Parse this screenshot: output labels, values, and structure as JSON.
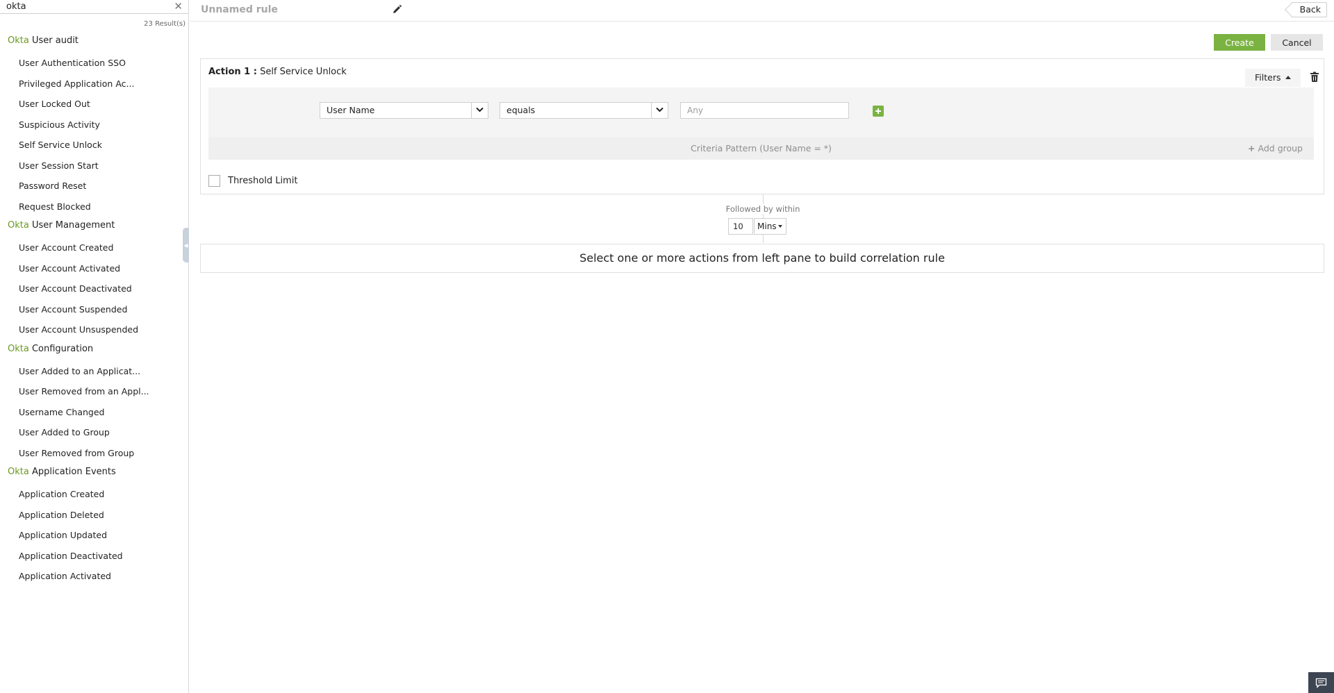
{
  "sidebar": {
    "search": {
      "value": "okta",
      "clear_icon": "close-icon"
    },
    "result_count": "23 Result(s)",
    "groups": [
      {
        "brand": "Okta",
        "name": "User audit",
        "items": [
          "User Authentication SSO",
          "Privileged Application Ac...",
          "User Locked Out",
          "Suspicious Activity",
          "Self Service Unlock",
          "User Session Start",
          "Password Reset",
          "Request Blocked"
        ]
      },
      {
        "brand": "Okta",
        "name": "User Management",
        "items": [
          "User Account Created",
          "User Account Activated",
          "User Account Deactivated",
          "User Account Suspended",
          "User Account Unsuspended"
        ]
      },
      {
        "brand": "Okta",
        "name": "Configuration",
        "items": [
          "User Added to an Applicat...",
          "User Removed from an Appl...",
          "Username Changed",
          "User Added to Group",
          "User Removed from Group"
        ]
      },
      {
        "brand": "Okta",
        "name": "Application Events",
        "items": [
          "Application Created",
          "Application Deleted",
          "Application Updated",
          "Application Deactivated",
          "Application Activated"
        ]
      }
    ]
  },
  "header": {
    "rule_name": "Unnamed rule",
    "edit_icon": "pencil-icon",
    "back_label": "Back"
  },
  "toolbar": {
    "create_label": "Create",
    "cancel_label": "Cancel"
  },
  "action": {
    "label": "Action 1 :",
    "name": "Self Service Unlock",
    "filters_label": "Filters",
    "delete_icon": "trash-icon",
    "criteria": {
      "field": "User Name",
      "operator": "equals",
      "value_placeholder": "Any"
    },
    "criteria_pattern": "Criteria Pattern (User Name = *)",
    "add_group_label": "Add group",
    "threshold_label": "Threshold Limit",
    "threshold_checked": false
  },
  "followed_by": {
    "label": "Followed by within",
    "value": "10",
    "unit": "Mins"
  },
  "empty_hint": "Select one or more actions from left pane to build correlation rule",
  "colors": {
    "accent_green": "#7bb342",
    "brand_green": "#6a9a1f",
    "feedback_bg": "#3d4552"
  },
  "feedback_icon": "chat-icon"
}
